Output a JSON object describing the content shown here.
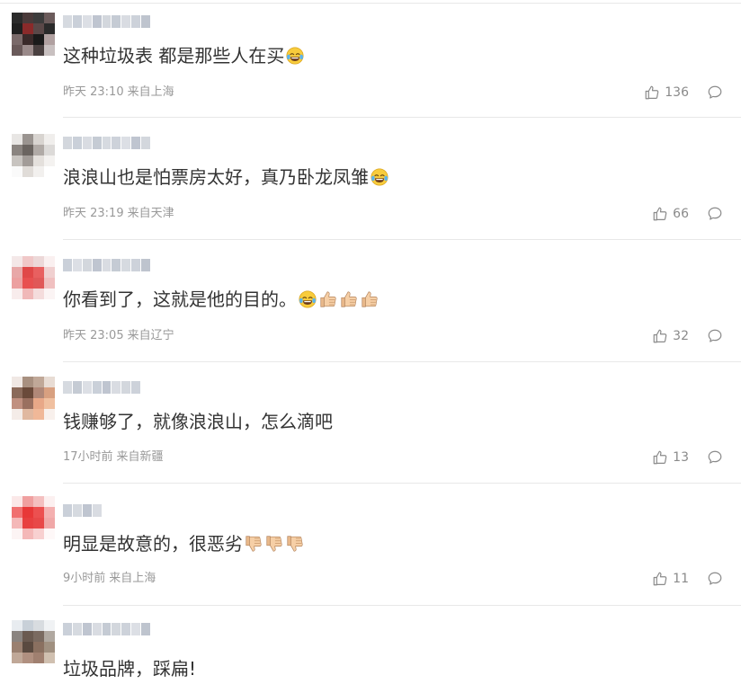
{
  "comments": [
    {
      "username": "",
      "text": "这种垃圾表 都是那些人在买",
      "emojis": [
        "laugh-cry"
      ],
      "time": "昨天 23:10",
      "location": "来自上海",
      "likes": "136",
      "avatar_colors": [
        "#2b2b2b",
        "#4a3a3a",
        "#3c3c3c",
        "#6b5b5b",
        "#202020",
        "#8a2a2a",
        "#5a4848",
        "#2a2a2a",
        "#7a6a6a",
        "#3a2a2a",
        "#1a1a1a",
        "#b0a0a0",
        "#6a5a5a",
        "#9a8a8a",
        "#4a4040",
        "#c8c0c0"
      ],
      "name_colors": [
        "#c8cdd6",
        "#b8c0cc",
        "#d0d4dc",
        "#a9b2c0",
        "#c4c9d2",
        "#b2bac6",
        "#ccd0d8",
        "#bcc3ce",
        "#a8b0be"
      ]
    },
    {
      "username": "",
      "text": "浪浪山也是怕票房太好，真乃卧龙凤雏",
      "emojis": [
        "laugh-cry"
      ],
      "time": "昨天 23:19",
      "location": "来自天津",
      "likes": "66",
      "avatar_colors": [
        "#e8e6e4",
        "#9a9490",
        "#d8d4d0",
        "#f0eeec",
        "#8a8480",
        "#6a6460",
        "#b0aaa6",
        "#dcdad8",
        "#c8c4c0",
        "#a29c98",
        "#e4e0dc",
        "#f4f2f0",
        "#fafafa",
        "#e0dcd8",
        "#f2f0ee",
        "#ffffff"
      ],
      "name_colors": [
        "#c4c9d2",
        "#b8c0cc",
        "#ccd0d8",
        "#b2bac6",
        "#c8cdd6",
        "#bcc3ce",
        "#d0d4dc",
        "#a9b2c0",
        "#c4c9d2"
      ]
    },
    {
      "username": "",
      "text": "你看到了，这就是他的目的。",
      "emojis": [
        "laugh-cry",
        "thumbs-up",
        "thumbs-up",
        "thumbs-up"
      ],
      "time": "昨天 23:05",
      "location": "来自辽宁",
      "likes": "32",
      "avatar_colors": [
        "#f4e8e8",
        "#f0c8c8",
        "#ecd8d8",
        "#faf0f0",
        "#e8a8a8",
        "#e04848",
        "#e86060",
        "#f0d0d0",
        "#eca0a0",
        "#e85050",
        "#e05858",
        "#f0c0c0",
        "#f8ecec",
        "#f0b8b8",
        "#f4dcdc",
        "#fbf4f4"
      ],
      "name_colors": [
        "#b8c0cc",
        "#d0d4dc",
        "#c4c9d2",
        "#a9b2c0",
        "#ccd0d8",
        "#b2bac6",
        "#c8cdd6",
        "#bcc3ce",
        "#a8b0be"
      ]
    },
    {
      "username": "",
      "text": "钱赚够了，就像浪浪山，怎么滴吧",
      "emojis": [],
      "time": "17小时前",
      "location": "来自新疆",
      "likes": "13",
      "avatar_colors": [
        "#f0e8e4",
        "#a89080",
        "#c0a898",
        "#e8dcd4",
        "#8a6a5a",
        "#6a4a3a",
        "#b08878",
        "#d8a080",
        "#c09080",
        "#9a7060",
        "#e8a888",
        "#f0c0a0",
        "#f4ece8",
        "#e0b8a0",
        "#f0b898",
        "#f8f0ec"
      ],
      "name_colors": [
        "#c8cdd6",
        "#b2bac6",
        "#d0d4dc",
        "#b8c0cc",
        "#a9b2c0",
        "#ccd0d8",
        "#c4c9d2",
        "#bcc3ce",
        "#ffffff"
      ]
    },
    {
      "username": "",
      "text": "明显是故意的，很恶劣",
      "emojis": [
        "thumbs-down",
        "thumbs-down",
        "thumbs-down"
      ],
      "time": "9小时前",
      "location": "来自上海",
      "likes": "11",
      "avatar_colors": [
        "#fbe8e8",
        "#f0a0a0",
        "#f4c0c0",
        "#fcf0f0",
        "#f07070",
        "#e83838",
        "#ec5050",
        "#f4b0b0",
        "#f4b8b8",
        "#e84040",
        "#e84848",
        "#f0a8a8",
        "#fcf4f4",
        "#f4b8b8",
        "#f8d0d0",
        "#fef8f8"
      ],
      "name_colors": [
        "#b8c0cc",
        "#c8cdd6",
        "#a9b2c0",
        "#ccd0d8",
        "#ffffff",
        "#ffffff",
        "#ffffff",
        "#ffffff",
        "#ffffff"
      ]
    },
    {
      "username": "",
      "text": "垃圾品牌，踩扁!",
      "emojis": [],
      "time": "",
      "location": "",
      "likes": "",
      "avatar_colors": [
        "#e8ecf0",
        "#c8d0d8",
        "#d8dce0",
        "#f0f2f4",
        "#8a8480",
        "#6a5a50",
        "#7a6a60",
        "#b0a8a0",
        "#9a8070",
        "#5a4a40",
        "#8a7060",
        "#a09080",
        "#c0a898",
        "#b09080",
        "#a08070",
        "#d0c0b0"
      ],
      "name_colors": [
        "#b8c0cc",
        "#c8cdd6",
        "#a9b2c0",
        "#ccd0d8",
        "#b2bac6",
        "#c4c9d2",
        "#bcc3ce",
        "#d0d4dc",
        "#a8b0be"
      ]
    }
  ]
}
